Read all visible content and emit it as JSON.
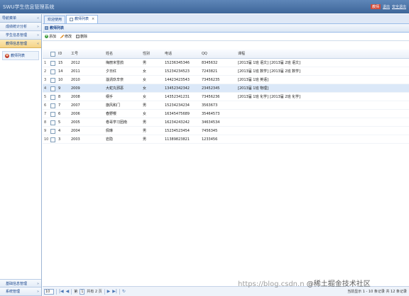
{
  "app": {
    "title": "SWU学生信息管理系统",
    "user_label": "教师",
    "logout": "退出",
    "exit_system": "安全退出"
  },
  "sidebar": {
    "header": "导航菜单",
    "items": [
      {
        "label": "成绩统计分析"
      },
      {
        "label": "学生信息管理"
      },
      {
        "label": "教师信息管理"
      }
    ],
    "sub_item": "教师列表",
    "bottom_items": [
      {
        "label": "基础信息管理"
      },
      {
        "label": "系统管理"
      }
    ]
  },
  "tabs": [
    {
      "label": "欢迎使用"
    },
    {
      "label": "教师列表"
    }
  ],
  "panel": {
    "title": "教师列表",
    "toolbar": {
      "add": "添加",
      "edit": "修改",
      "delete": "删除"
    }
  },
  "table": {
    "headers": {
      "id": "ID",
      "no": "工号",
      "name": "姓名",
      "sex": "性别",
      "tel": "电话",
      "qq": "QQ",
      "course": "课程"
    },
    "rows": [
      {
        "num": "1",
        "id": "15",
        "no": "2012",
        "name": "梅丽米雪鸽",
        "sex": "男",
        "tel": "15236345346",
        "qq": "8345632",
        "courses": [
          "[2013届 1班 语文]",
          "[2013届 2班 语文]"
        ]
      },
      {
        "num": "2",
        "id": "14",
        "no": "2011",
        "name": "夕日红",
        "sex": "女",
        "tel": "15234234523",
        "qq": "7243821",
        "courses": [
          "[2013届 1班 数学]",
          "[2013届 2班 数学]"
        ]
      },
      {
        "num": "3",
        "id": "10",
        "no": "2010",
        "name": "漩涡玖辛奈",
        "sex": "女",
        "tel": "14423423543",
        "qq": "73456235",
        "courses": [
          "[2013届 1班 英语]"
        ]
      },
      {
        "num": "4",
        "id": "9",
        "no": "2009",
        "name": "大蛇丸邪恶",
        "sex": "女",
        "tel": "13452342342",
        "qq": "23452345",
        "courses": [
          "[2013届 1班 物理]"
        ]
      },
      {
        "num": "5",
        "id": "8",
        "no": "2008",
        "name": "纲手",
        "sex": "女",
        "tel": "14352341231",
        "qq": "73456236",
        "courses": [
          "[2013届 1班 化学]",
          "[2013届 2班 化学]"
        ]
      },
      {
        "num": "6",
        "id": "7",
        "no": "2007",
        "name": "旗风和门",
        "sex": "男",
        "tel": "15234234234",
        "qq": "3563673",
        "courses": []
      },
      {
        "num": "7",
        "id": "6",
        "no": "2006",
        "name": "春野樱",
        "sex": "女",
        "tel": "16345475689",
        "qq": "35464573",
        "courses": []
      },
      {
        "num": "8",
        "id": "5",
        "no": "2005",
        "name": "卷哥学习团南",
        "sex": "男",
        "tel": "16234243242",
        "qq": "34634534",
        "courses": []
      },
      {
        "num": "9",
        "id": "4",
        "no": "2004",
        "name": "佩琳",
        "sex": "男",
        "tel": "15234523454",
        "qq": "7456345",
        "courses": []
      },
      {
        "num": "10",
        "id": "3",
        "no": "2003",
        "name": "岩隐",
        "sex": "男",
        "tel": "11389823821",
        "qq": "1233456",
        "courses": []
      }
    ],
    "selected_row": 3
  },
  "pager": {
    "page_size": "10",
    "page_label_pre": "第",
    "current_page": "1",
    "page_label_post": "共有 2 页",
    "info": "当前显示 1 - 10 条记录 共 12 条记录"
  },
  "watermark": {
    "url": "https://blog.csdn.n",
    "brand": "@稀土掘金技术社区"
  }
}
